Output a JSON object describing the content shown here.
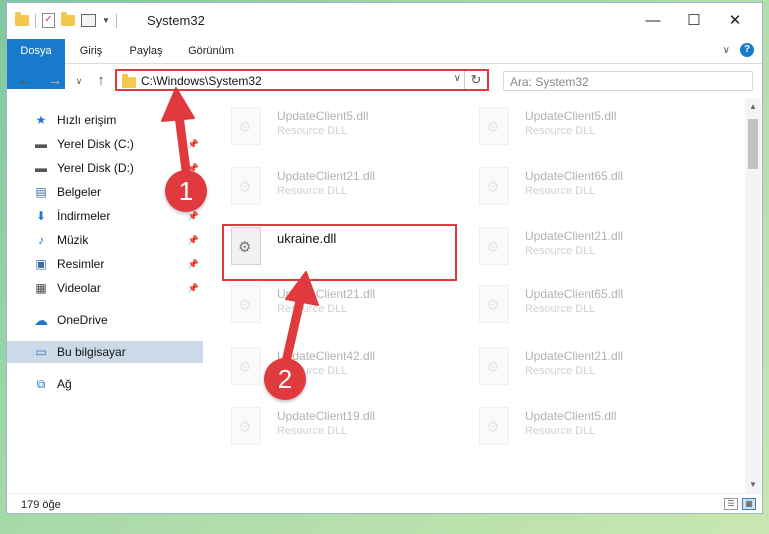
{
  "window": {
    "title": "System32",
    "controls": [
      "—",
      "☐",
      "✕"
    ]
  },
  "ribbon": {
    "tabs": [
      "Dosya",
      "Giriş",
      "Paylaş",
      "Görünüm"
    ]
  },
  "address": {
    "path": "C:\\Windows\\System32",
    "search_placeholder": "Ara: System32"
  },
  "nav": {
    "items": [
      {
        "label": "Hızlı erişim",
        "icon": "star-icon",
        "pinned": false
      },
      {
        "label": "Yerel Disk (C:)",
        "icon": "drive-icon",
        "pinned": true
      },
      {
        "label": "Yerel Disk (D:)",
        "icon": "drive-icon",
        "pinned": true
      },
      {
        "label": "Belgeler",
        "icon": "document-icon",
        "pinned": true
      },
      {
        "label": "İndirmeler",
        "icon": "download-icon",
        "pinned": true
      },
      {
        "label": "Müzik",
        "icon": "music-icon",
        "pinned": true
      },
      {
        "label": "Resimler",
        "icon": "picture-icon",
        "pinned": true
      },
      {
        "label": "Videolar",
        "icon": "video-icon",
        "pinned": true
      },
      {
        "label": "OneDrive",
        "icon": "cloud-icon",
        "pinned": false
      },
      {
        "label": "Bu bilgisayar",
        "icon": "computer-icon",
        "pinned": false,
        "selected": true
      },
      {
        "label": "Ağ",
        "icon": "network-icon",
        "pinned": false
      }
    ]
  },
  "files": [
    {
      "name": "UpdateClient5.dll",
      "type": "Resource DLL"
    },
    {
      "name": "UpdateClient5.dll",
      "type": "Resource DLL"
    },
    {
      "name": "UpdateClient21.dll",
      "type": "Resource DLL"
    },
    {
      "name": "UpdateClient65.dll",
      "type": "Resource DLL"
    },
    {
      "name": "ukraine.dll",
      "type": ""
    },
    {
      "name": "UpdateClient21.dll",
      "type": "Resource DLL"
    },
    {
      "name": "UpdateClient21.dll",
      "type": "Resource DLL"
    },
    {
      "name": "UpdateClient65.dll",
      "type": "Resource DLL"
    },
    {
      "name": "UpdateClient42.dll",
      "type": "Resource DLL"
    },
    {
      "name": "UpdateClient21.dll",
      "type": "Resource DLL"
    },
    {
      "name": "UpdateClient19.dll",
      "type": "Resource DLL"
    },
    {
      "name": "UpdateClient5.dll",
      "type": "Resource DLL"
    }
  ],
  "status": {
    "count": "179 öğe"
  },
  "annotations": {
    "badge1": "1",
    "badge2": "2",
    "color": "#e0393e"
  }
}
